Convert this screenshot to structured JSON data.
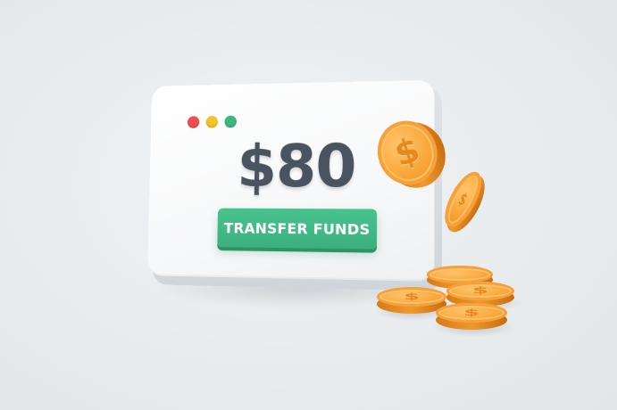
{
  "card": {
    "amount": "$80",
    "button_label": "TRANSFER FUNDS"
  },
  "window_dots": {
    "colors": [
      "#ee4f4f",
      "#f5c42c",
      "#3cb87f"
    ]
  },
  "colors": {
    "accent_green": "#3bb07e",
    "amount_text": "#4a5461",
    "coin_gold": "#f8a73a"
  },
  "icons": {
    "coin_symbol": "$"
  }
}
